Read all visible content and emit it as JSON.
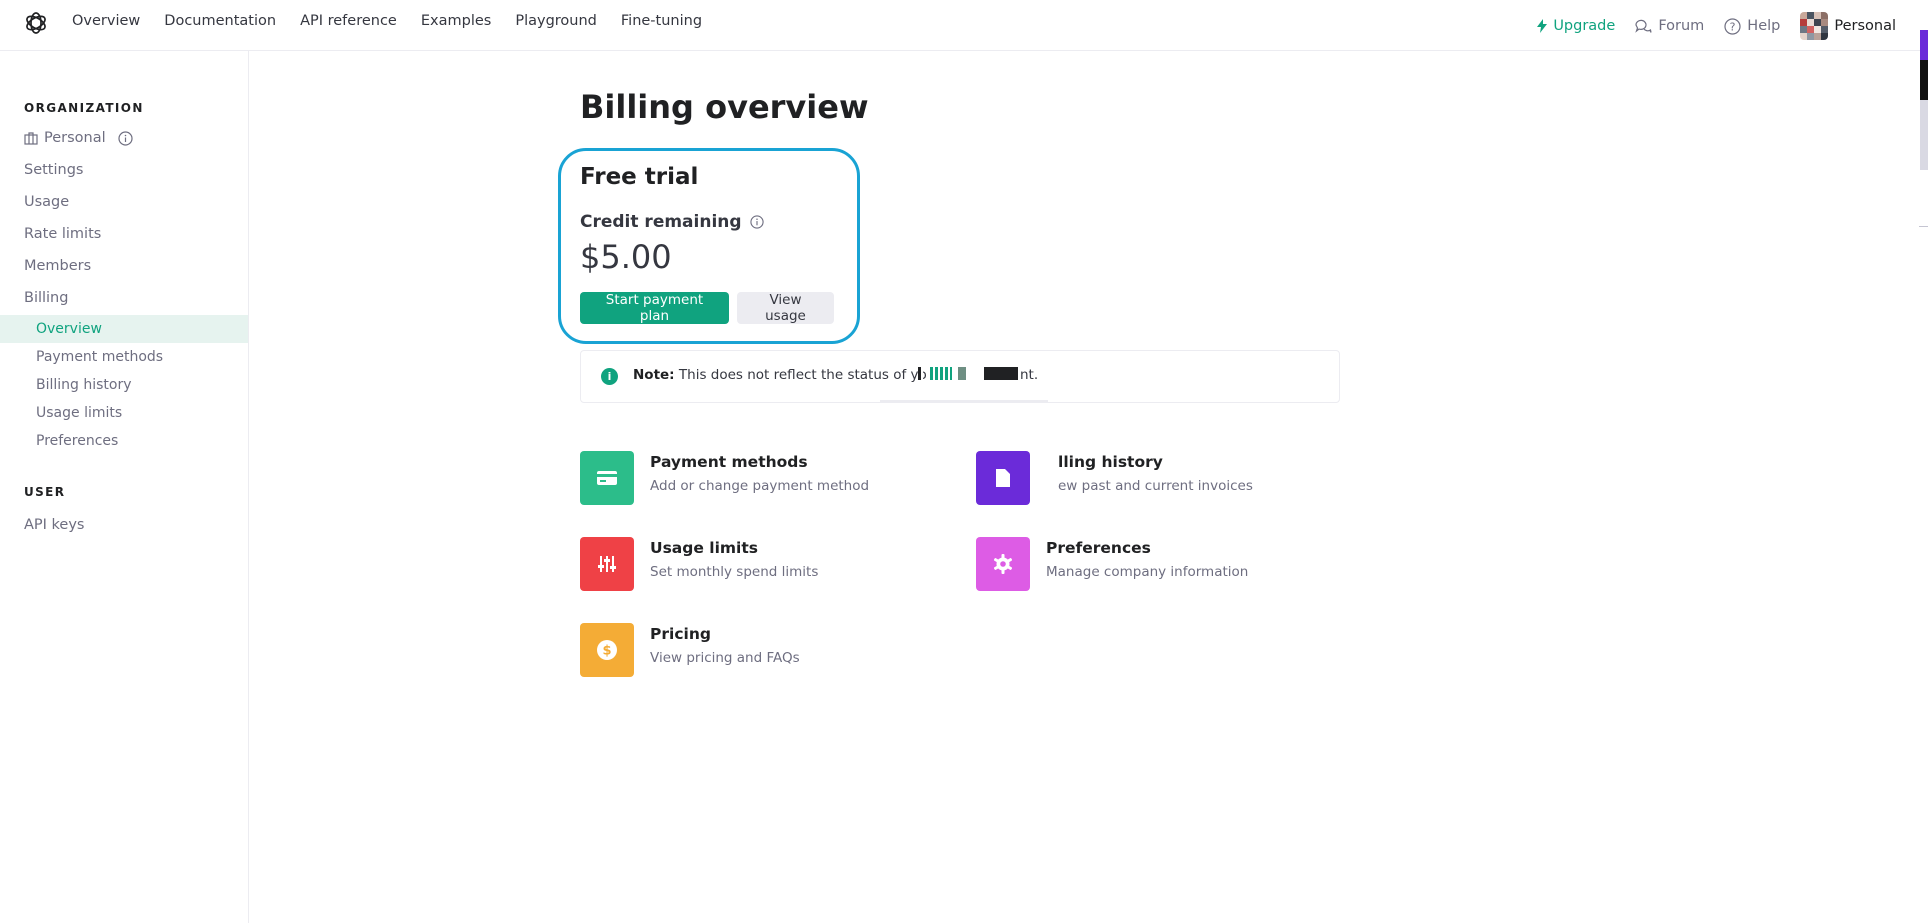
{
  "nav": {
    "links": [
      "Overview",
      "Documentation",
      "API reference",
      "Examples",
      "Playground",
      "Fine-tuning"
    ],
    "upgrade_label": "Upgrade",
    "forum_label": "Forum",
    "help_label": "Help",
    "account_label": "Personal"
  },
  "sidebar": {
    "org_heading": "ORGANIZATION",
    "org_name": "Personal",
    "items": [
      "Settings",
      "Usage",
      "Rate limits",
      "Members",
      "Billing"
    ],
    "billing_sub": [
      "Overview",
      "Payment methods",
      "Billing history",
      "Usage limits",
      "Preferences"
    ],
    "active_sub": "Overview",
    "user_heading": "USER",
    "user_items": [
      "API keys"
    ]
  },
  "main": {
    "title": "Billing overview",
    "trial": {
      "title": "Free trial",
      "credit_label": "Credit remaining",
      "credit_value": "$5.00",
      "start_button": "Start payment plan",
      "usage_button": "View usage"
    },
    "note": {
      "label": "Note:",
      "text_visible": "This does not reflect the status of yo",
      "text_tail": "nt."
    },
    "tiles": [
      {
        "title": "Payment methods",
        "desc": "Add or change payment method",
        "color": "#19c37d",
        "icon": "credit-card-icon"
      },
      {
        "title": "lling history",
        "desc": "ew past and current invoices",
        "color": "#6b2bd9",
        "icon": "document-icon"
      },
      {
        "title": "Usage limits",
        "desc": "Set monthly spend limits",
        "color": "#ef4146",
        "icon": "sliders-icon"
      },
      {
        "title": "Preferences",
        "desc": "Manage company information",
        "color": "#dd5ce5",
        "icon": "gear-icon"
      },
      {
        "title": "Pricing",
        "desc": "View pricing and FAQs",
        "color": "#f4ac36",
        "icon": "dollar-coin-icon"
      }
    ]
  },
  "colors": {
    "accent": "#10a37f",
    "highlight_border": "#19a3d4",
    "active_bg": "#e6f3ef"
  }
}
